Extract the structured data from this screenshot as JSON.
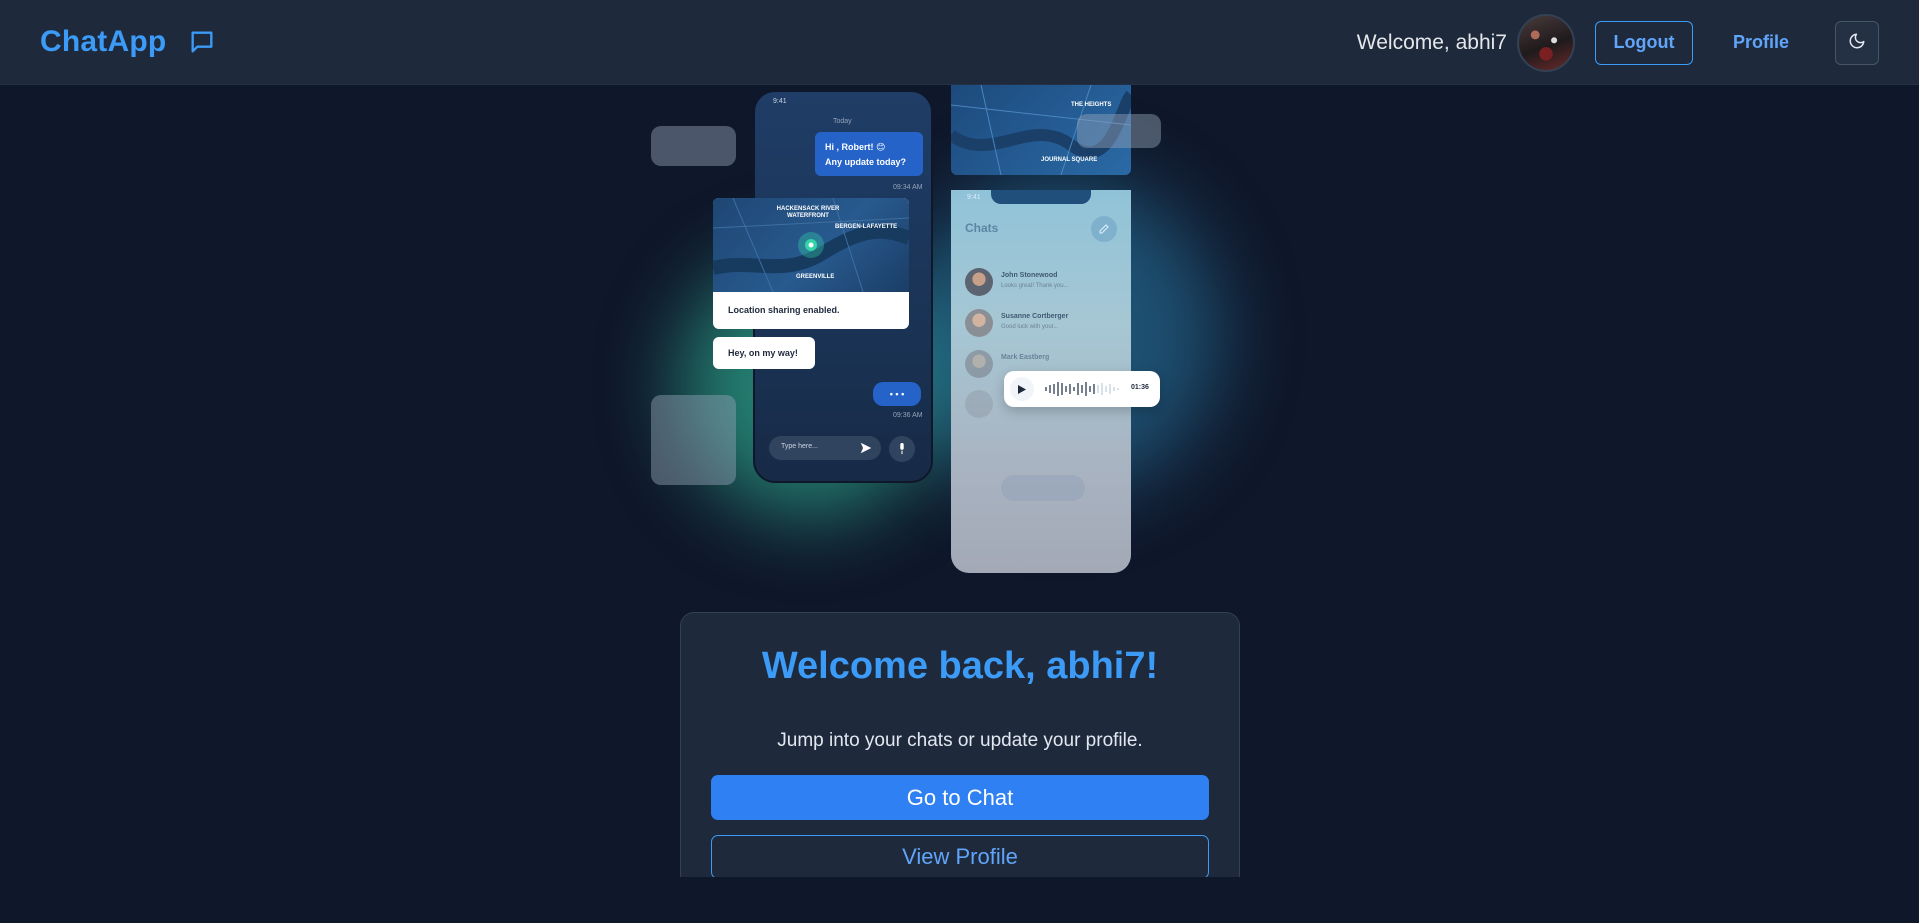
{
  "navbar": {
    "brand": "ChatApp",
    "brand_icon": "chat-bubble-icon",
    "welcome": "Welcome, abhi7",
    "logout_label": "Logout",
    "profile_label": "Profile",
    "theme_icon": "moon-icon",
    "accent_color": "#3b9bf7"
  },
  "illustration": {
    "left_phone": {
      "time": "9:41",
      "day": "Today",
      "greeting_line1": "Hi , Robert! 😊",
      "greeting_line2": "Any update today?",
      "time1": "09:34 AM",
      "map_label1": "HACKENSACK RIVER WATERFRONT",
      "map_label2": "BERGEN-LAFAYETTE",
      "map_label3": "GREENVILLE",
      "location_msg": "Location sharing enabled.",
      "reply_msg": "Hey, on my way!",
      "time2": "09:36 AM",
      "input_placeholder": "Type here..."
    },
    "right_phone": {
      "time": "9:41",
      "header": "Chats",
      "map_label1": "THE HEIGHTS",
      "map_label2": "JOURNAL SQUARE",
      "contacts": [
        {
          "name": "John Stonewood",
          "preview": "Looks great! Thank you..."
        },
        {
          "name": "Susanne Cortberger",
          "preview": "Good luck with your..."
        },
        {
          "name": "Mark Eastberg",
          "preview": ""
        }
      ],
      "voice_duration": "01:36"
    }
  },
  "welcome_card": {
    "heading": "Welcome back, abhi7!",
    "subtitle": "Jump into your chats or update your profile.",
    "chat_button": "Go to Chat",
    "profile_button": "View Profile"
  }
}
